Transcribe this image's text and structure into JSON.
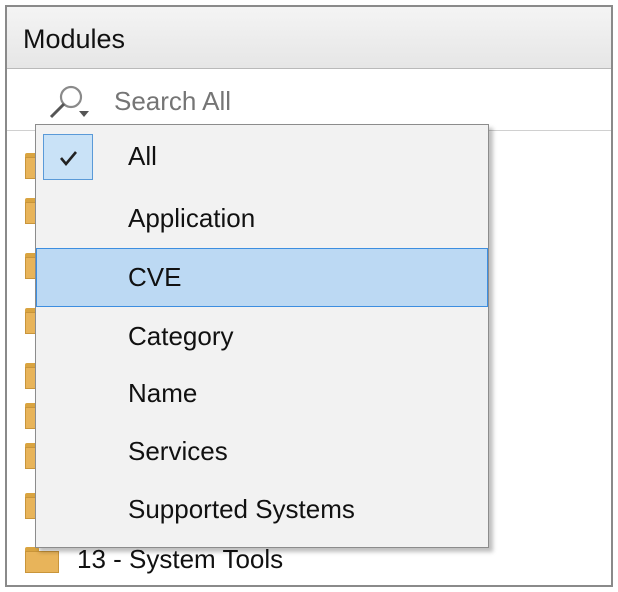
{
  "panel": {
    "title": "Modules"
  },
  "search": {
    "placeholder": "Search All",
    "icon": "search-icon"
  },
  "tree": {
    "visible_item_label": "13 - System Tools"
  },
  "dropdown": {
    "selected": "All",
    "highlighted": "CVE",
    "items": [
      {
        "label": "All",
        "checked": true
      },
      {
        "label": "Application",
        "checked": false
      },
      {
        "label": "CVE",
        "checked": false
      },
      {
        "label": "Category",
        "checked": false
      },
      {
        "label": "Name",
        "checked": false
      },
      {
        "label": "Services",
        "checked": false
      },
      {
        "label": "Supported Systems",
        "checked": false
      }
    ]
  },
  "colors": {
    "highlight_bg": "#bcd9f3",
    "highlight_border": "#3d8ee0",
    "menu_bg": "#f2f2f2",
    "folder": "#e8b45a"
  }
}
